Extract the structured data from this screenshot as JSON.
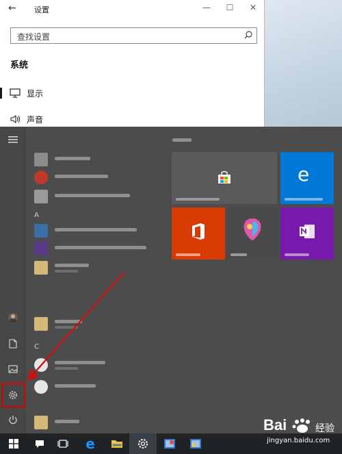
{
  "settings_window": {
    "title": "设置",
    "search_placeholder": "查找设置",
    "section_title": "系统",
    "nav_items": [
      {
        "label": "显示",
        "icon": "monitor-icon"
      },
      {
        "label": "声音",
        "icon": "speaker-icon"
      }
    ],
    "controls": {
      "back": "←",
      "minimize": "—",
      "maximize": "☐",
      "close": "✕"
    }
  },
  "start_menu": {
    "rail_icons": [
      "hamburger-menu-icon",
      "user-avatar",
      "document-icon",
      "pictures-icon",
      "settings-gear-icon",
      "power-icon"
    ],
    "letters": [
      "A",
      "C"
    ],
    "colors": {
      "background": "#4c4c4c",
      "highlight_box": "#dd0000",
      "office_tile": "#d83b01",
      "edge_tile": "#0078d7",
      "onenote_tile": "#7719aa"
    }
  },
  "taskbar": {
    "icons": [
      "windows-start-icon",
      "cortana-icon",
      "task-view-icon",
      "edge-icon",
      "file-explorer-icon",
      "settings-icon",
      "app-icon-1",
      "app-icon-2"
    ]
  },
  "watermark": {
    "brand": "Bai",
    "suffix": "经验",
    "url": "jingyan.baidu.com"
  }
}
